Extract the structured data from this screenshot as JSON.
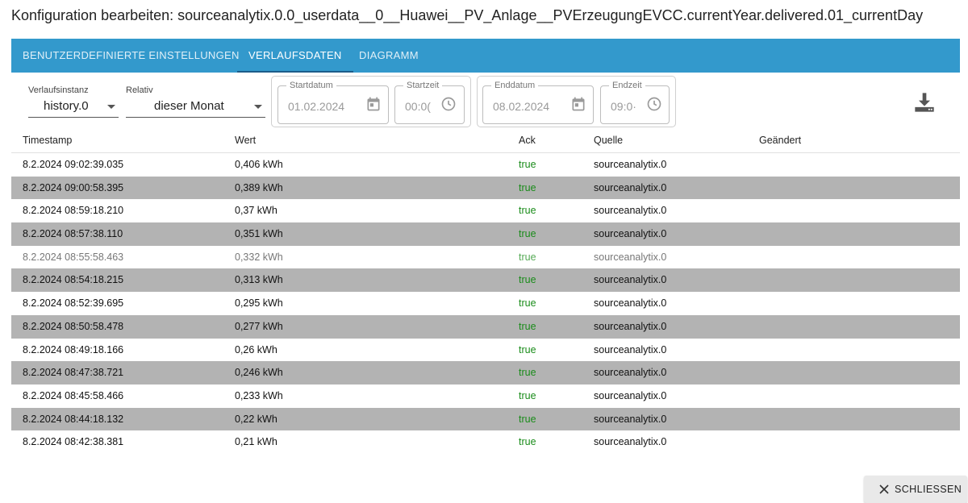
{
  "dialog": {
    "title": "Konfiguration bearbeiten: sourceanalytix.0.0_userdata__0__Huawei__PV_Anlage__PVErzeugungEVCC.currentYear.delivered.01_currentDay"
  },
  "tabs": [
    {
      "label": "BENUTZERDEFINIERTE EINSTELLUNGEN"
    },
    {
      "label": "VERLAUFSDATEN"
    },
    {
      "label": "DIAGRAMM"
    }
  ],
  "controls": {
    "instance_label": "Verlaufsinstanz",
    "instance_value": "history.0",
    "relative_label": "Relativ",
    "relative_value": "dieser Monat",
    "start_date_label": "Startdatum",
    "start_date_value": "01.02.2024",
    "start_time_label": "Startzeit",
    "start_time_value": "00:0(",
    "end_date_label": "Enddatum",
    "end_date_value": "08.02.2024",
    "end_time_label": "Endzeit",
    "end_time_value": "09:0·"
  },
  "table": {
    "headers": {
      "timestamp": "Timestamp",
      "value": "Wert",
      "ack": "Ack",
      "source": "Quelle",
      "changed": "Geändert"
    },
    "rows": [
      {
        "ts": "8.2.2024 09:02:39.035",
        "val": "0,406 kWh",
        "ack": "true",
        "src": "sourceanalytix.0"
      },
      {
        "ts": "8.2.2024 09:00:58.395",
        "val": "0,389 kWh",
        "ack": "true",
        "src": "sourceanalytix.0"
      },
      {
        "ts": "8.2.2024 08:59:18.210",
        "val": "0,37 kWh",
        "ack": "true",
        "src": "sourceanalytix.0"
      },
      {
        "ts": "8.2.2024 08:57:38.110",
        "val": "0,351 kWh",
        "ack": "true",
        "src": "sourceanalytix.0"
      },
      {
        "ts": "8.2.2024 08:55:58.463",
        "val": "0,332 kWh",
        "ack": "true",
        "src": "sourceanalytix.0"
      },
      {
        "ts": "8.2.2024 08:54:18.215",
        "val": "0,313 kWh",
        "ack": "true",
        "src": "sourceanalytix.0"
      },
      {
        "ts": "8.2.2024 08:52:39.695",
        "val": "0,295 kWh",
        "ack": "true",
        "src": "sourceanalytix.0"
      },
      {
        "ts": "8.2.2024 08:50:58.478",
        "val": "0,277 kWh",
        "ack": "true",
        "src": "sourceanalytix.0"
      },
      {
        "ts": "8.2.2024 08:49:18.166",
        "val": "0,26 kWh",
        "ack": "true",
        "src": "sourceanalytix.0"
      },
      {
        "ts": "8.2.2024 08:47:38.721",
        "val": "0,246 kWh",
        "ack": "true",
        "src": "sourceanalytix.0"
      },
      {
        "ts": "8.2.2024 08:45:58.466",
        "val": "0,233 kWh",
        "ack": "true",
        "src": "sourceanalytix.0"
      },
      {
        "ts": "8.2.2024 08:44:18.132",
        "val": "0,22 kWh",
        "ack": "true",
        "src": "sourceanalytix.0"
      },
      {
        "ts": "8.2.2024 08:42:38.381",
        "val": "0,21 kWh",
        "ack": "true",
        "src": "sourceanalytix.0"
      }
    ]
  },
  "footer": {
    "close_label": "SCHLIESSEN"
  },
  "icons": {
    "calendar": "calendar-icon",
    "clock": "clock-icon",
    "download": "download-icon",
    "close": "close-icon"
  },
  "colors": {
    "tabbar": "#3399cc",
    "ack_true": "#1a8c1a",
    "row_alt": "#b3b3b3"
  }
}
